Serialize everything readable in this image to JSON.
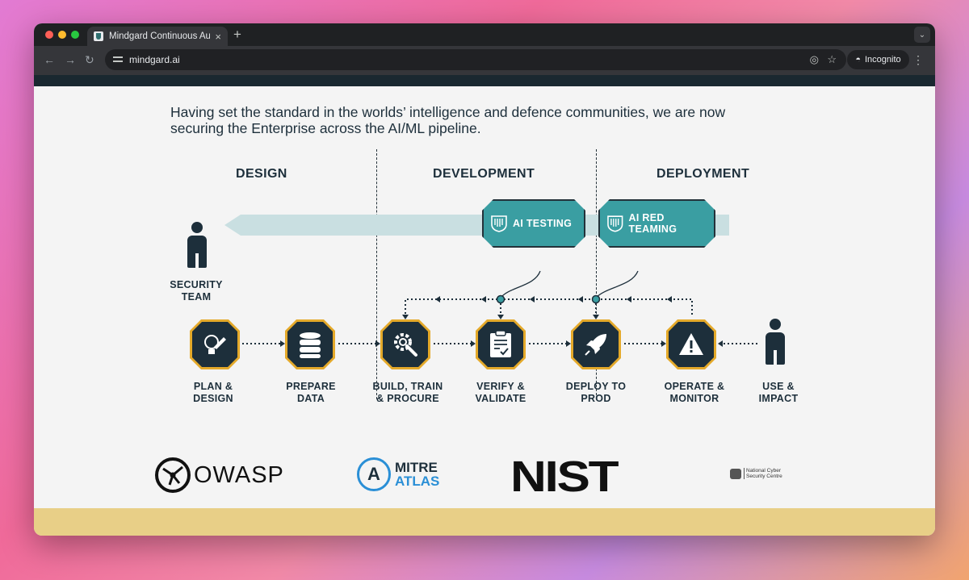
{
  "browser": {
    "tab_title": "Mindgard Continuous Autom",
    "tab_close": "×",
    "new_tab": "+",
    "url": "mindgard.ai",
    "incognito_label": "Incognito"
  },
  "page": {
    "headline_line1": "Having set the standard in the worlds’ intelligence and defence communities, we are now",
    "headline_line2": "securing the Enterprise across the AI/ML pipeline.",
    "phases": [
      "DESIGN",
      "DEVELOPMENT",
      "DEPLOYMENT"
    ],
    "badges": [
      "AI TESTING",
      "AI RED TEAMING"
    ],
    "security_team": [
      "SECURITY",
      "TEAM"
    ],
    "stages": [
      {
        "line1": "PLAN &",
        "line2": "DESIGN",
        "icon": "pencil-bulb-icon"
      },
      {
        "line1": "PREPARE",
        "line2": "DATA",
        "icon": "database-icon"
      },
      {
        "line1": "BUILD, TRAIN",
        "line2": "& PROCURE",
        "icon": "gear-wrench-icon"
      },
      {
        "line1": "VERIFY &",
        "line2": "VALIDATE",
        "icon": "clipboard-check-icon"
      },
      {
        "line1": "DEPLOY TO",
        "line2": "PROD",
        "icon": "rocket-icon"
      },
      {
        "line1": "OPERATE &",
        "line2": "MONITOR",
        "icon": "warning-icon"
      }
    ],
    "use_impact": [
      "USE &",
      "IMPACT"
    ],
    "logos": {
      "owasp": "OWASP",
      "mitre_1": "MITRE",
      "mitre_2": "ATLAS",
      "mitre_mark": "A",
      "nist": "NIST",
      "ncsc_1": "National Cyber",
      "ncsc_2": "Security Centre"
    }
  },
  "colors": {
    "navy": "#1d2f3b",
    "teal": "#3a9ea2",
    "gold": "#e4a92a",
    "arrow_band": "#c9dfe1",
    "footer_band": "#e8cf87"
  }
}
